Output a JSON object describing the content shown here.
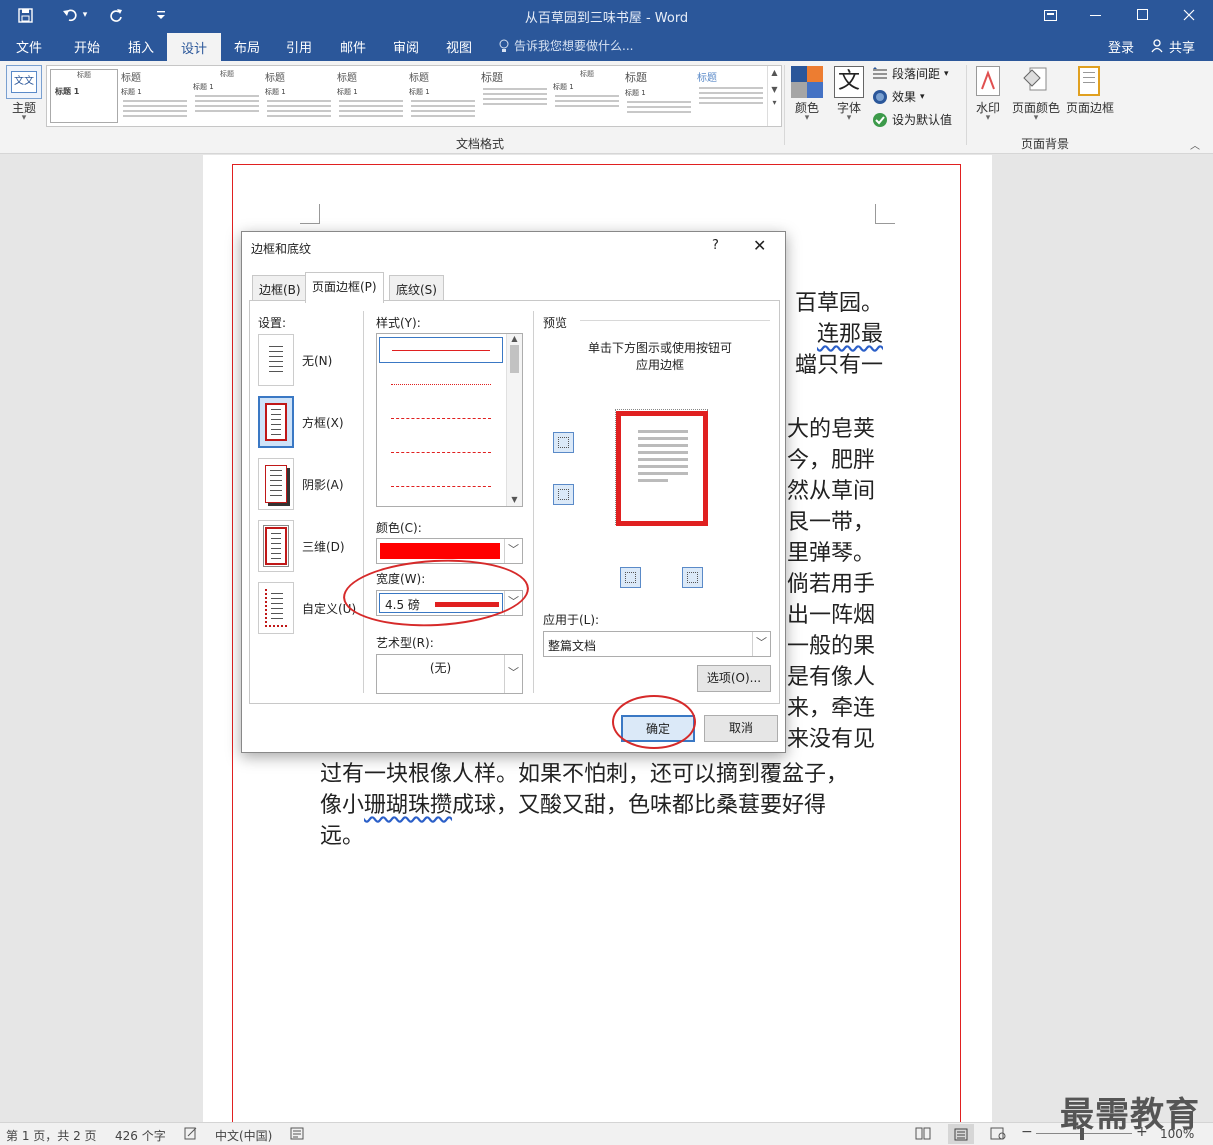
{
  "window": {
    "title": "从百草园到三味书屋 - Word"
  },
  "quick_access": {
    "save_icon": "save-icon",
    "undo_icon": "undo-icon",
    "redo_icon": "redo-icon",
    "customize_icon": "customize-icon"
  },
  "tabs": [
    {
      "label": "文件"
    },
    {
      "label": "开始"
    },
    {
      "label": "插入"
    },
    {
      "label": "设计"
    },
    {
      "label": "布局"
    },
    {
      "label": "引用"
    },
    {
      "label": "邮件"
    },
    {
      "label": "审阅"
    },
    {
      "label": "视图"
    }
  ],
  "tell_me": "告诉我您想要做什么...",
  "account": {
    "signin": "登录",
    "share": "共享"
  },
  "ribbon": {
    "theme_label": "主题",
    "gallery": [
      {
        "heading": "标题",
        "sub": "标题 1"
      },
      {
        "heading": "标题",
        "sub": "标题 1"
      },
      {
        "heading": "标题",
        "sub": "标题 1"
      },
      {
        "heading": "标题",
        "sub": "标题 1"
      },
      {
        "heading": "标题",
        "sub": "标题 1"
      },
      {
        "heading": "标题",
        "sub": "标题 1"
      },
      {
        "heading": "标题",
        "sub": "标题 1"
      },
      {
        "heading": "标题",
        "sub": "标题 1"
      },
      {
        "heading": "标题",
        "sub": "标题 1"
      },
      {
        "heading": "标题",
        "sub": "标题 1"
      }
    ],
    "group_doc_format": "文档格式",
    "colors_label": "颜色",
    "fonts_label": "字体",
    "fonts_icon_char": "文",
    "paragraph_spacing": "段落间距",
    "effects": "效果",
    "set_default": "设为默认值",
    "watermark": "水印",
    "page_color": "页面颜色",
    "page_borders": "页面边框",
    "group_page_bg": "页面背景"
  },
  "document": {
    "lines": [
      {
        "text": "百草园。",
        "wavy": false
      },
      {
        "text": "连那最",
        "wavy": true
      },
      {
        "text": "蟷只有一",
        "wavy": false
      },
      {
        "text": "大的皂荚",
        "wavy": false
      },
      {
        "text": "今，肥胖",
        "wavy": false
      },
      {
        "text": "然从草间",
        "wavy": false
      },
      {
        "text": "艮一带，",
        "wavy": false
      },
      {
        "text": "里弹琴。",
        "wavy": false
      },
      {
        "text": "倘若用手",
        "wavy": false
      },
      {
        "text": "出一阵烟",
        "wavy": false
      },
      {
        "text": "一般的果",
        "wavy": false
      },
      {
        "text": "是有像人",
        "wavy": false
      },
      {
        "text": "来，牵连",
        "wavy": false
      },
      {
        "text": "来没有见",
        "wavy": false
      }
    ],
    "full_line_1": "过有一块根像人样。如果不怕刺，还可以摘到覆盆子，",
    "full_line_2a": "像小",
    "full_line_2b": "珊瑚珠攒",
    "full_line_2c": "成球，又酸又甜，色味都比桑葚要好得",
    "full_line_3": "远。"
  },
  "dialog": {
    "title": "边框和底纹",
    "help": "?",
    "close": "✕",
    "tabs": [
      {
        "label": "边框(B)"
      },
      {
        "label": "页面边框(P)"
      },
      {
        "label": "底纹(S)"
      }
    ],
    "settings_label": "设置:",
    "settings": [
      {
        "label": "无(N)"
      },
      {
        "label": "方框(X)"
      },
      {
        "label": "阴影(A)"
      },
      {
        "label": "三维(D)"
      },
      {
        "label": "自定义(U)"
      }
    ],
    "style_label": "样式(Y):",
    "color_label": "颜色(C):",
    "color_value": "#ff0000",
    "width_label": "宽度(W):",
    "width_value": "4.5 磅",
    "art_label": "艺术型(R):",
    "art_value": "(无)",
    "preview_label": "预览",
    "preview_hint_1": "单击下方图示或使用按钮可",
    "preview_hint_2": "应用边框",
    "apply_label": "应用于(L):",
    "apply_value": "整篇文档",
    "options_btn": "选项(O)...",
    "ok_btn": "确定",
    "cancel_btn": "取消"
  },
  "status": {
    "page": "第 1 页，共 2 页",
    "words": "426 个字",
    "lang": "中文(中国)",
    "zoom": "100%"
  },
  "watermark_text": "最需教育"
}
